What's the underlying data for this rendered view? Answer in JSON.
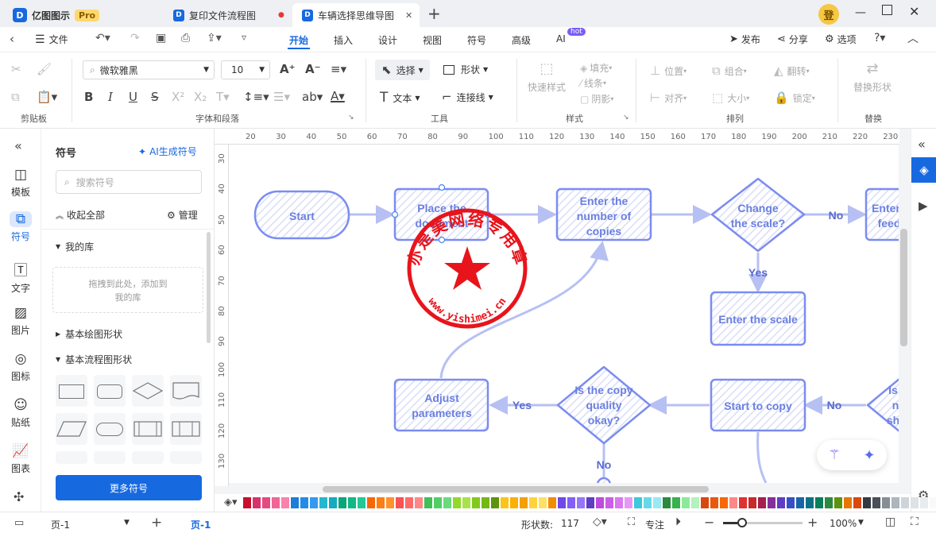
{
  "app": {
    "name": "亿图图示",
    "badge": "Pro"
  },
  "tabs": [
    {
      "label": "复印文件流程图",
      "modified_dot": "●"
    },
    {
      "label": "车辆选择思维导图",
      "close": "✕"
    }
  ],
  "window": {
    "user_avatar": "登",
    "add_tab": "+"
  },
  "menubar": {
    "file_label": "文件",
    "tabs": [
      "开始",
      "插入",
      "设计",
      "视图",
      "符号",
      "高级",
      "AI"
    ],
    "ai_badge": "hot",
    "publish": "发布",
    "share": "分享",
    "options": "选项"
  },
  "ribbon": {
    "groups": {
      "clipboard": "剪贴板",
      "font": "字体和段落",
      "tools": "工具",
      "style": "样式",
      "arrange": "排列",
      "replace": "替换"
    },
    "font_name": "微软雅黑",
    "font_size": "10",
    "select": "选择",
    "shape": "形状",
    "text": "文本",
    "connector": "连接线",
    "quick_style": "快速样式",
    "fill": "填充",
    "line": "线条",
    "shadow": "阴影",
    "position": "位置",
    "group": "组合",
    "flip": "翻转",
    "align": "对齐",
    "size": "大小",
    "lock": "锁定",
    "replace_shape": "替换形状"
  },
  "leftbar": [
    "模板",
    "符号",
    "文字",
    "图片",
    "图标",
    "贴纸",
    "图表"
  ],
  "panel": {
    "title": "符号",
    "ai_generate": "AI生成符号",
    "search_placeholder": "搜索符号",
    "collapse_all": "收起全部",
    "manage": "管理",
    "my_library": "我的库",
    "drop_hint_1": "拖拽到此处，添加到",
    "drop_hint_2": "我的库",
    "basic_shapes": "基本绘图形状",
    "basic_flow": "基本流程图形状",
    "more_symbols": "更多符号"
  },
  "ruler": {
    "top": [
      "20",
      "30",
      "40",
      "50",
      "60",
      "70",
      "80",
      "90",
      "100",
      "110",
      "120",
      "130",
      "140",
      "150",
      "160",
      "170",
      "180",
      "190",
      "200",
      "210",
      "220",
      "230"
    ],
    "left": [
      "30",
      "40",
      "50",
      "60",
      "70",
      "80",
      "90",
      "100",
      "110",
      "120",
      "130"
    ]
  },
  "flowchart": {
    "nodes": {
      "start": "Start",
      "place_1": "Place the",
      "place_2": "document",
      "enter_copies_1": "Enter the",
      "enter_copies_2": "number of",
      "enter_copies_3": "copies",
      "change_scale_1": "Change",
      "change_scale_2": "the scale?",
      "enter_feed_1": "Enter",
      "enter_feed_2": "feed",
      "enter_scale": "Enter the scale",
      "adjust_1": "Adjust",
      "adjust_2": "parameters",
      "quality_1": "Is the copy",
      "quality_2": "quality",
      "quality_3": "okay?",
      "start_copy": "Start to copy",
      "is_1": "Is",
      "is_2": "n",
      "is_3": "sh"
    },
    "labels": {
      "no_1": "No",
      "yes_1": "Yes",
      "yes_2": "Yes",
      "no_2": "No",
      "no_3": "No"
    },
    "colors": {
      "stroke": "#7b8cf0",
      "text": "#6b7fe0",
      "hatch": "#dde2fb"
    }
  },
  "stamp": {
    "text": "亦是美网络专用章",
    "url": "www.yishimei.cn",
    "color": "#e8141c"
  },
  "statusbar": {
    "page": "页-1",
    "page_tab": "页-1",
    "shape_count_label": "形状数:",
    "shape_count": "117",
    "focus": "专注",
    "zoom": "100%"
  },
  "palette_colors": [
    "#c8102e",
    "#d6336c",
    "#e64980",
    "#f06595",
    "#f783ac",
    "#1c7ed6",
    "#228be6",
    "#339af0",
    "#22b8cf",
    "#15aabf",
    "#0ca678",
    "#12b886",
    "#20c997",
    "#f76707",
    "#fd7e14",
    "#ff922b",
    "#fa5252",
    "#ff6b6b",
    "#ff8787",
    "#40c057",
    "#51cf66",
    "#69db7c",
    "#94d82d",
    "#a9e34b",
    "#82c91e",
    "#74b816",
    "#5c940d",
    "#fcc419",
    "#fab005",
    "#f59f00",
    "#ffd43b",
    "#ffe066",
    "#f08c00",
    "#7048e8",
    "#845ef7",
    "#9775fa",
    "#5f3dc4",
    "#be4bdb",
    "#cc5de8",
    "#da77f2",
    "#e599f7",
    "#3bc9db",
    "#66d9e8",
    "#99e9f2",
    "#2b8a3e",
    "#37b24d",
    "#8ce99a",
    "#b2f2bb",
    "#d9480f",
    "#e8590c",
    "#f76707",
    "#ff8787",
    "#e03131",
    "#c92a2a",
    "#a61e4d",
    "#862e9c",
    "#5f3dc4",
    "#364fc7",
    "#1864ab",
    "#0b7285",
    "#087f5b",
    "#2b8a3e",
    "#5c940d",
    "#e67700",
    "#d9480f",
    "#343a40",
    "#495057",
    "#868e96",
    "#adb5bd",
    "#ced4da",
    "#dee2e6",
    "#e9ecef",
    "#f8f9fa"
  ]
}
